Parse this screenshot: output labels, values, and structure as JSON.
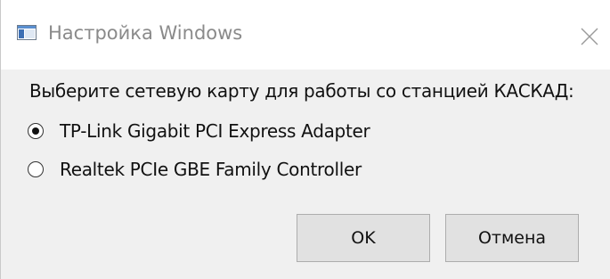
{
  "window": {
    "title": "Настройка Windows",
    "icon": "window-app-icon",
    "close_icon": "close-icon"
  },
  "dialog": {
    "prompt": "Выберите сетевую карту для работы со станцией КАСКАД:",
    "options": [
      {
        "label": "TP-Link Gigabit PCI Express Adapter",
        "checked": true
      },
      {
        "label": "Realtek PCIe GBE Family Controller",
        "checked": false
      }
    ],
    "buttons": {
      "ok_label": "OK",
      "cancel_label": "Отмена"
    }
  },
  "colors": {
    "window_bg": "#f0f0f0",
    "titlebar_bg": "#ffffff",
    "title_text": "#8a8a8a",
    "button_bg": "#e1e1e1",
    "button_border": "#adadad"
  }
}
